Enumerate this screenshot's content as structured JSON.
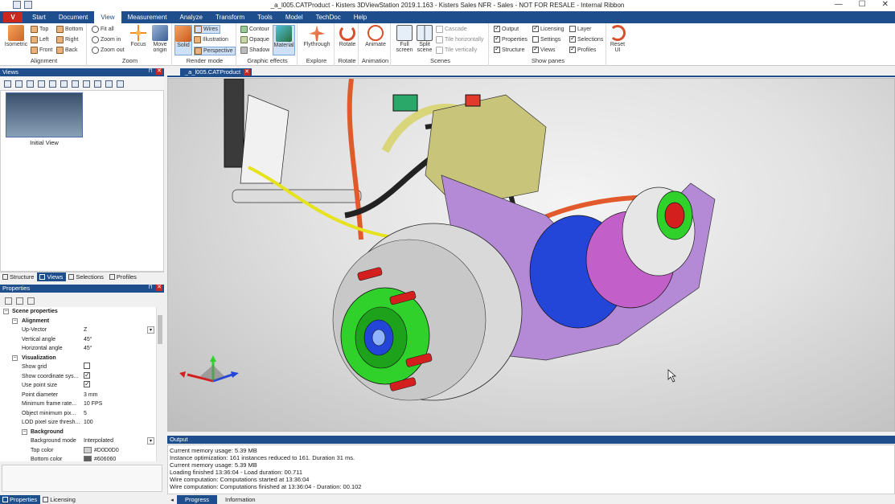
{
  "window": {
    "title": "_a_l005.CATProduct - Kisters 3DViewStation 2019.1.163 - Kisters Sales NFR - Sales - NOT FOR RESALE - Internal Ribbon",
    "minimize": "—",
    "maximize": "☐",
    "close": "✕"
  },
  "menu": {
    "app_button": "V",
    "tabs": [
      "Start",
      "Document",
      "View",
      "Measurement",
      "Analyze",
      "Transform",
      "Tools",
      "Model",
      "TechDoc",
      "Help"
    ],
    "active_tab": "View"
  },
  "ribbon": {
    "alignment": {
      "label": "Alignment",
      "isometric": "Isometric",
      "top": "Top",
      "left": "Left",
      "front": "Front",
      "bottom": "Bottom",
      "right": "Right",
      "back": "Back"
    },
    "zoom": {
      "label": "Zoom",
      "fit_all": "Fit all",
      "zoom_in": "Zoom in",
      "zoom_out": "Zoom out",
      "focus": "Focus",
      "move_origin_1": "Move",
      "move_origin_2": "origin"
    },
    "render_mode": {
      "label": "Render mode",
      "solid": "Solid",
      "wires": "Wires",
      "illustration": "Illustration",
      "perspective": "Perspective",
      "material": "Material"
    },
    "graphic_effects": {
      "label": "Graphic effects",
      "contour": "Contour",
      "opaque": "Opaque",
      "shadow": "Shadow"
    },
    "explore": {
      "label": "Explore",
      "flythrough": "Flythrough"
    },
    "rotate": {
      "label": "Rotate",
      "rotate": "Rotate"
    },
    "animation": {
      "label": "Animation",
      "animate": "Animate"
    },
    "scenes": {
      "label": "Scenes",
      "full_screen_1": "Full",
      "full_screen_2": "screen",
      "split_scene_1": "Split",
      "split_scene_2": "scene",
      "cascade": "Cascade",
      "tile_h": "Tile horizontally",
      "tile_v": "Tile vertically"
    },
    "show_panes": {
      "label": "Show panes",
      "output": "Output",
      "properties": "Properties",
      "structure": "Structure",
      "licensing": "Licensing",
      "settings": "Settings",
      "views": "Views",
      "layer": "Layer",
      "selections": "Selections",
      "profiles": "Profiles"
    },
    "reset_ui_1": "Reset",
    "reset_ui_2": "UI"
  },
  "views_panel": {
    "title": "Views",
    "thumbnail_label": "Initial View",
    "tabs": [
      "Structure",
      "Views",
      "Selections",
      "Profiles"
    ],
    "active_tab": "Views"
  },
  "properties_panel": {
    "title": "Properties",
    "scene_properties": "Scene properties",
    "alignment": "Alignment",
    "up_vector": {
      "key": "Up-Vector",
      "value": "Z"
    },
    "vertical_angle": {
      "key": "Vertical angle",
      "value": "45°"
    },
    "horizontal_angle": {
      "key": "Horizontal angle",
      "value": "45°"
    },
    "visualization": "Visualization",
    "show_grid": {
      "key": "Show grid",
      "checked": false
    },
    "show_coord": {
      "key": "Show coordinate sys...",
      "checked": true
    },
    "use_point_size": {
      "key": "Use point size",
      "checked": true
    },
    "point_diameter": {
      "key": "Point diameter",
      "value": "3 mm"
    },
    "min_frame_rate": {
      "key": "Minimum frame rate...",
      "value": "10 FPS"
    },
    "object_min_pix": {
      "key": "Object minimum pix...",
      "value": "5"
    },
    "lod_pixel": {
      "key": "LOD pixel size thresh...",
      "value": "100"
    },
    "background": "Background",
    "background_mode": {
      "key": "Background mode",
      "value": "Interpolated"
    },
    "top_color": {
      "key": "Top color",
      "value": "#D0D0D0",
      "swatch": "#D0D0D0"
    },
    "bottom_color": {
      "key": "Bottom color",
      "value": "#606060",
      "swatch": "#606060"
    },
    "bottom_tabs": [
      "Properties",
      "Licensing"
    ],
    "active_bottom_tab": "Properties"
  },
  "document": {
    "tab_label": "_a_l005.CATProduct"
  },
  "output_panel": {
    "title": "Output",
    "lines": [
      "Current memory usage: 5.39 MB",
      "Instance optimization: 161 instances reduced to 161. Duration 31 ms.",
      "Current memory usage: 5.39 MB",
      "Loading finished 13:36:04 - Load duration: 00.711",
      "Wire computation: Computations started at 13:36:04",
      "Wire computation: Computations finished at 13:36:04 - Duration: 00.102"
    ],
    "tabs": [
      "Progress",
      "Information"
    ],
    "active_tab": "Progress"
  },
  "colors": {
    "accent": "#1e4e8c",
    "close_red": "#c8281e",
    "model_purple": "#b48ad6",
    "model_green": "#2fd12a",
    "model_blue": "#2346d8",
    "model_red": "#d41f1f",
    "model_orange": "#e25a2b",
    "model_yellow": "#e6e21b"
  }
}
